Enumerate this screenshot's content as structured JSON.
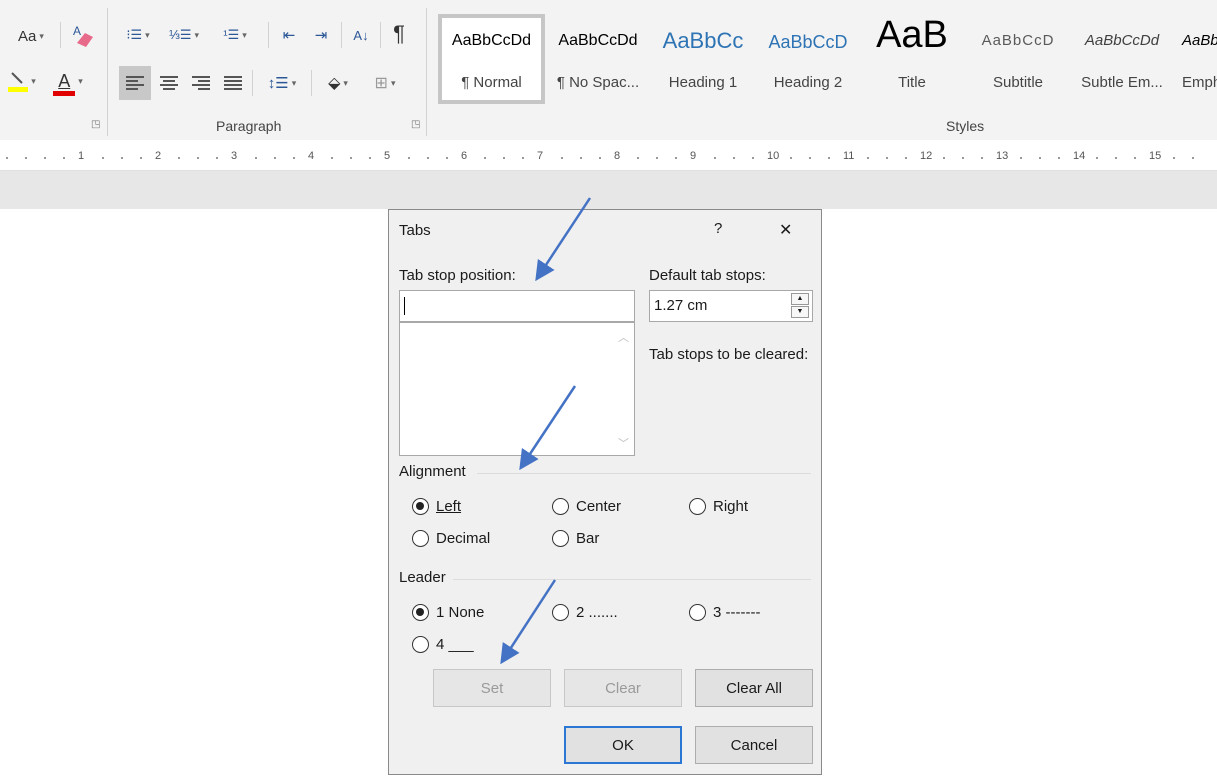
{
  "ribbon": {
    "font_group": {
      "change_case_label": "Aa",
      "font_color_label": "A",
      "highlight_color": "#ffff00",
      "font_color": "#e00000"
    },
    "paragraph_group": {
      "label": "Paragraph",
      "pilcrow": "¶",
      "sort_label": "A↓"
    },
    "styles_group": {
      "label": "Styles",
      "items": [
        {
          "sample": "AaBbCcDd",
          "name": "¶ Normal"
        },
        {
          "sample": "AaBbCcDd",
          "name": "¶ No Spac..."
        },
        {
          "sample": "AaBbCc",
          "name": "Heading 1"
        },
        {
          "sample": "AaBbCcD",
          "name": "Heading 2"
        },
        {
          "sample": "AaB",
          "name": "Title"
        },
        {
          "sample": "AaBbCcD",
          "name": "Subtitle"
        },
        {
          "sample": "AaBbCcDd",
          "name": "Subtle Em..."
        },
        {
          "sample": "AaBbCcDd",
          "name": "Emphasis"
        }
      ]
    }
  },
  "ruler": {
    "numbers": [
      "1",
      "2",
      "3",
      "4",
      "5",
      "6",
      "7",
      "8",
      "9",
      "10",
      "11",
      "12",
      "13",
      "14",
      "15"
    ]
  },
  "dialog": {
    "title": "Tabs",
    "help": "?",
    "close": "✕",
    "tab_stop_position_label": "Tab stop position:",
    "tab_stop_position_value": "",
    "default_tab_stops_label": "Default tab stops:",
    "default_tab_stops_value": "1.27 cm",
    "tab_stops_to_be_cleared_label": "Tab stops to be cleared:",
    "alignment": {
      "label": "Alignment",
      "options": [
        "Left",
        "Center",
        "Right",
        "Decimal",
        "Bar"
      ],
      "selected": "Left"
    },
    "leader": {
      "label": "Leader",
      "options": [
        "1 None",
        "2 .......",
        "3 -------",
        "4 ___"
      ],
      "selected": "1 None"
    },
    "buttons": {
      "set": "Set",
      "clear": "Clear",
      "clear_all": "Clear All",
      "ok": "OK",
      "cancel": "Cancel"
    }
  },
  "colors": {
    "annotation_arrow": "#4472c4",
    "default_button_border": "#2a78d4"
  }
}
